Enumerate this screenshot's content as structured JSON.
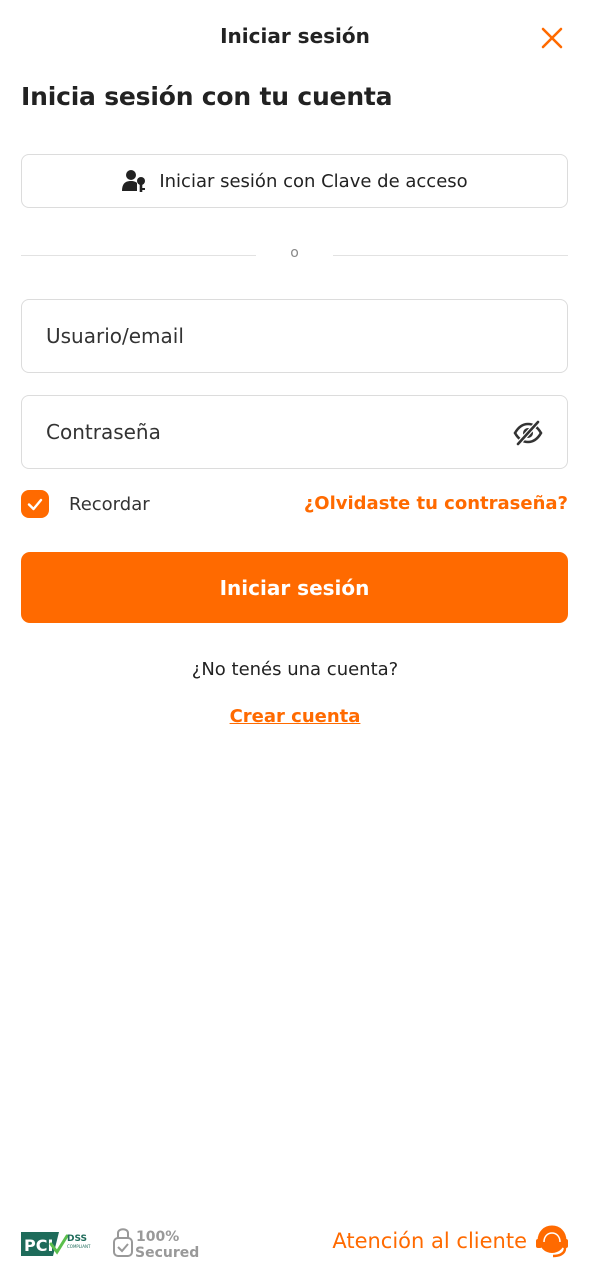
{
  "header": {
    "title": "Iniciar sesión",
    "close_icon": "close-icon"
  },
  "page_title": "Inicia sesión con tu cuenta",
  "passkey": {
    "label": "Iniciar sesión con Clave de acceso",
    "icon": "user-key-icon"
  },
  "divider": {
    "text": "o"
  },
  "form": {
    "username_placeholder": "Usuario/email",
    "password_placeholder": "Contraseña",
    "password_toggle_icon": "eye-slash-icon",
    "remember_label": "Recordar",
    "remember_checked": true,
    "forgot_label": "¿Olvidaste tu contraseña?",
    "submit_label": "Iniciar sesión"
  },
  "signup": {
    "prompt": "¿No tenés una cuenta?",
    "link": "Crear cuenta"
  },
  "footer": {
    "pci_logo_text": "PCI DSS COMPLIANT",
    "secured_badge_text": "100% Secured",
    "support_label": "Atención al cliente",
    "support_icon": "headset-icon"
  },
  "colors": {
    "accent": "#ff6a00",
    "text": "#222222",
    "border": "#dcdcdc",
    "pci_green": "#1e6b5a"
  }
}
